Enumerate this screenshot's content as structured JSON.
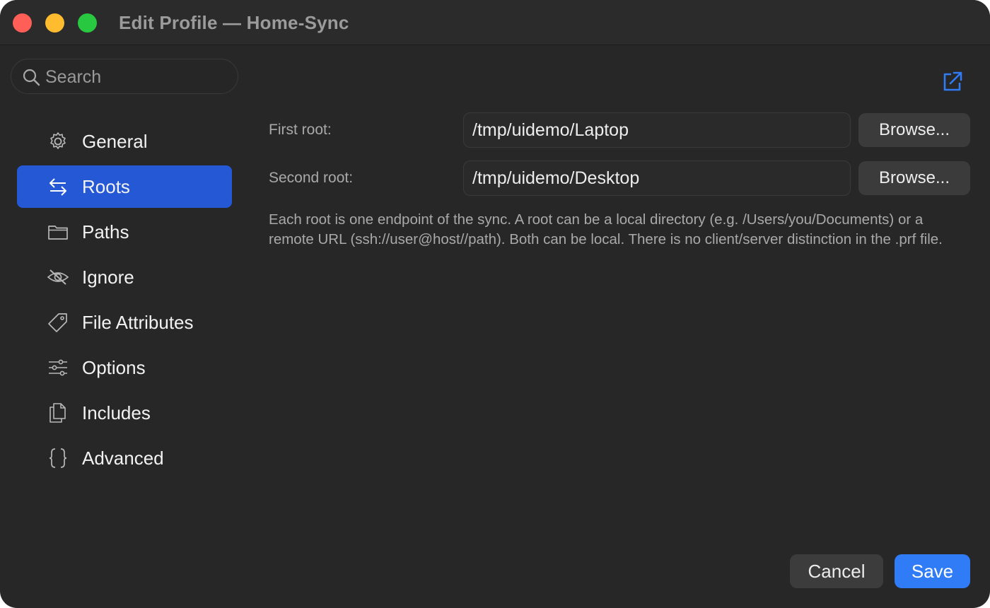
{
  "window": {
    "title": "Edit Profile — Home-Sync"
  },
  "search": {
    "placeholder": "Search"
  },
  "sidebar": {
    "items": [
      {
        "label": "General",
        "icon": "gear-icon"
      },
      {
        "label": "Roots",
        "icon": "arrows-swap-icon",
        "active": true
      },
      {
        "label": "Paths",
        "icon": "folder-icon"
      },
      {
        "label": "Ignore",
        "icon": "eye-slash-icon"
      },
      {
        "label": "File Attributes",
        "icon": "tag-icon"
      },
      {
        "label": "Options",
        "icon": "sliders-icon"
      },
      {
        "label": "Includes",
        "icon": "documents-icon"
      },
      {
        "label": "Advanced",
        "icon": "braces-icon"
      }
    ]
  },
  "roots": {
    "first_label": "First root:",
    "first_value": "/tmp/uidemo/Laptop",
    "second_label": "Second root:",
    "second_value": "/tmp/uidemo/Desktop",
    "browse_label": "Browse...",
    "help": "Each root is one endpoint of the sync. A root can be a local directory (e.g. /Users/you/Documents) or a remote URL (ssh://user@host//path). Both can be local. There is no client/server distinction in the .prf file."
  },
  "footer": {
    "cancel_label": "Cancel",
    "save_label": "Save"
  },
  "colors": {
    "accent": "#2f7cf6",
    "selection": "#2458d4",
    "background": "#272727"
  }
}
